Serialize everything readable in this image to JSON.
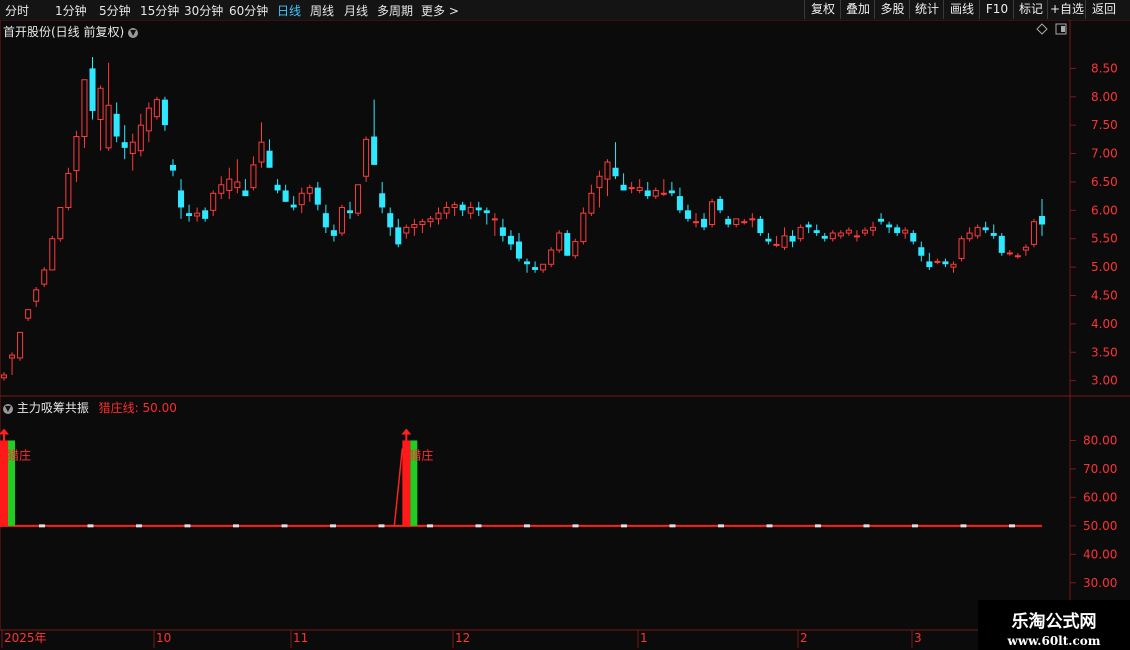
{
  "toolbar": {
    "periods": [
      "分时",
      "1分钟",
      "5分钟",
      "15分钟",
      "30分钟",
      "60分钟",
      "日线",
      "周线",
      "月线",
      "多周期",
      "更多"
    ],
    "active_period": "日线",
    "more_arrow": ">",
    "buttons": [
      "复权",
      "叠加",
      "多股",
      "统计",
      "画线",
      "F10",
      "标记",
      "+自选",
      "返回"
    ]
  },
  "chart": {
    "title": "首开股份(日线 前复权)",
    "price_ticks": [
      "8.50",
      "8.00",
      "7.50",
      "7.00",
      "6.50",
      "6.00",
      "5.50",
      "5.00",
      "4.50",
      "4.00",
      "3.50",
      "3.00"
    ],
    "x_labels": [
      "2025年",
      "10",
      "11",
      "12",
      "1",
      "2",
      "3"
    ]
  },
  "indicator": {
    "name": "主力吸筹共振",
    "line_label": "猎庄线: 50.00",
    "ticks": [
      "80.00",
      "70.00",
      "60.00",
      "50.00",
      "40.00",
      "30.00"
    ],
    "signal_label": "猎庄"
  },
  "watermark": {
    "line1": "乐淘公式网",
    "line2": "www.60lt.com"
  },
  "colors": {
    "up": "#ff3b3b",
    "down": "#2ee8ff",
    "signal_green": "#22cc22",
    "signal_red": "#ff1a1a",
    "axis": "#7a1a1a"
  },
  "chart_data": {
    "type": "candlestick",
    "ohlc": [
      [
        3.05,
        3.15,
        3.0,
        3.1
      ],
      [
        3.4,
        3.5,
        3.1,
        3.45
      ],
      [
        3.4,
        3.85,
        3.35,
        3.85
      ],
      [
        4.1,
        4.25,
        4.05,
        4.25
      ],
      [
        4.4,
        4.65,
        4.3,
        4.6
      ],
      [
        4.7,
        5.0,
        4.65,
        4.95
      ],
      [
        4.95,
        5.55,
        4.95,
        5.5
      ],
      [
        5.5,
        6.05,
        5.45,
        6.05
      ],
      [
        6.05,
        6.75,
        6.0,
        6.65
      ],
      [
        6.7,
        7.4,
        6.5,
        7.3
      ],
      [
        7.3,
        8.3,
        7.1,
        8.3
      ],
      [
        8.5,
        8.7,
        7.6,
        7.75
      ],
      [
        7.6,
        8.2,
        7.05,
        8.15
      ],
      [
        7.1,
        8.6,
        7.05,
        7.85
      ],
      [
        7.7,
        7.9,
        7.2,
        7.3
      ],
      [
        7.2,
        7.5,
        6.9,
        7.1
      ],
      [
        7.0,
        7.35,
        6.7,
        7.2
      ],
      [
        7.05,
        7.7,
        6.95,
        7.5
      ],
      [
        7.4,
        7.9,
        7.2,
        7.8
      ],
      [
        7.65,
        8.0,
        7.6,
        7.95
      ],
      [
        7.95,
        8.0,
        7.4,
        7.5
      ],
      [
        6.8,
        6.9,
        6.6,
        6.7
      ],
      [
        6.35,
        6.55,
        5.85,
        6.05
      ],
      [
        5.95,
        6.1,
        5.8,
        5.9
      ],
      [
        5.9,
        6.05,
        5.8,
        5.95
      ],
      [
        6.0,
        6.05,
        5.8,
        5.85
      ],
      [
        6.0,
        6.35,
        5.9,
        6.3
      ],
      [
        6.3,
        6.6,
        6.2,
        6.45
      ],
      [
        6.35,
        6.75,
        6.2,
        6.55
      ],
      [
        6.4,
        6.9,
        6.3,
        6.5
      ],
      [
        6.35,
        6.55,
        6.25,
        6.25
      ],
      [
        6.4,
        6.95,
        6.35,
        6.8
      ],
      [
        6.85,
        7.55,
        6.75,
        7.2
      ],
      [
        7.05,
        7.25,
        6.75,
        6.75
      ],
      [
        6.45,
        6.55,
        6.3,
        6.35
      ],
      [
        6.35,
        6.45,
        6.15,
        6.15
      ],
      [
        6.1,
        6.25,
        6.0,
        6.05
      ],
      [
        6.1,
        6.4,
        5.95,
        6.3
      ],
      [
        6.3,
        6.45,
        6.15,
        6.4
      ],
      [
        6.4,
        6.5,
        6.0,
        6.1
      ],
      [
        5.95,
        6.1,
        5.6,
        5.7
      ],
      [
        5.65,
        5.75,
        5.45,
        5.55
      ],
      [
        5.6,
        6.1,
        5.55,
        6.05
      ],
      [
        6.0,
        6.15,
        5.85,
        5.95
      ],
      [
        5.95,
        6.45,
        5.9,
        6.45
      ],
      [
        6.6,
        7.3,
        6.5,
        7.25
      ],
      [
        7.3,
        7.95,
        6.8,
        6.8
      ],
      [
        6.3,
        6.5,
        5.95,
        6.05
      ],
      [
        5.95,
        6.05,
        5.55,
        5.7
      ],
      [
        5.7,
        5.85,
        5.35,
        5.4
      ],
      [
        5.6,
        5.75,
        5.5,
        5.7
      ],
      [
        5.7,
        5.85,
        5.55,
        5.75
      ],
      [
        5.75,
        5.85,
        5.6,
        5.8
      ],
      [
        5.8,
        5.9,
        5.7,
        5.85
      ],
      [
        5.85,
        6.05,
        5.75,
        5.95
      ],
      [
        5.95,
        6.15,
        5.85,
        6.05
      ],
      [
        6.05,
        6.15,
        5.9,
        6.1
      ],
      [
        6.1,
        6.15,
        5.9,
        6.0
      ],
      [
        5.95,
        6.15,
        5.85,
        6.05
      ],
      [
        6.05,
        6.15,
        5.9,
        6.0
      ],
      [
        6.0,
        6.05,
        5.75,
        5.95
      ],
      [
        5.85,
        5.95,
        5.55,
        5.85
      ],
      [
        5.7,
        5.85,
        5.45,
        5.55
      ],
      [
        5.55,
        5.65,
        5.3,
        5.4
      ],
      [
        5.45,
        5.6,
        5.1,
        5.15
      ],
      [
        5.1,
        5.15,
        4.9,
        5.05
      ],
      [
        5.0,
        5.1,
        4.9,
        4.95
      ],
      [
        4.95,
        5.05,
        4.9,
        5.05
      ],
      [
        5.05,
        5.35,
        5.0,
        5.3
      ],
      [
        5.3,
        5.65,
        5.25,
        5.6
      ],
      [
        5.6,
        5.65,
        5.2,
        5.2
      ],
      [
        5.2,
        5.5,
        5.15,
        5.45
      ],
      [
        5.45,
        6.05,
        5.4,
        5.95
      ],
      [
        5.95,
        6.45,
        5.9,
        6.3
      ],
      [
        6.4,
        6.7,
        6.05,
        6.6
      ],
      [
        6.55,
        6.9,
        6.25,
        6.85
      ],
      [
        6.75,
        7.2,
        6.55,
        6.6
      ],
      [
        6.45,
        6.65,
        6.35,
        6.35
      ],
      [
        6.4,
        6.5,
        6.3,
        6.4
      ],
      [
        6.35,
        6.55,
        6.3,
        6.4
      ],
      [
        6.35,
        6.5,
        6.2,
        6.25
      ],
      [
        6.25,
        6.4,
        6.2,
        6.35
      ],
      [
        6.3,
        6.55,
        6.25,
        6.3
      ],
      [
        6.35,
        6.5,
        6.25,
        6.3
      ],
      [
        6.25,
        6.4,
        5.95,
        6.0
      ],
      [
        6.0,
        6.1,
        5.8,
        5.85
      ],
      [
        5.8,
        5.95,
        5.7,
        5.8
      ],
      [
        5.85,
        5.95,
        5.65,
        5.7
      ],
      [
        5.75,
        6.2,
        5.7,
        6.15
      ],
      [
        6.2,
        6.25,
        5.95,
        6.0
      ],
      [
        5.85,
        5.9,
        5.7,
        5.75
      ],
      [
        5.75,
        5.85,
        5.7,
        5.85
      ],
      [
        5.8,
        5.85,
        5.75,
        5.8
      ],
      [
        5.85,
        5.95,
        5.7,
        5.85
      ],
      [
        5.85,
        5.9,
        5.55,
        5.6
      ],
      [
        5.5,
        5.6,
        5.4,
        5.45
      ],
      [
        5.4,
        5.55,
        5.35,
        5.4
      ],
      [
        5.35,
        5.7,
        5.3,
        5.55
      ],
      [
        5.55,
        5.65,
        5.35,
        5.45
      ],
      [
        5.5,
        5.75,
        5.45,
        5.7
      ],
      [
        5.75,
        5.8,
        5.6,
        5.7
      ],
      [
        5.65,
        5.75,
        5.55,
        5.6
      ],
      [
        5.55,
        5.6,
        5.45,
        5.5
      ],
      [
        5.5,
        5.65,
        5.45,
        5.6
      ],
      [
        5.55,
        5.65,
        5.5,
        5.6
      ],
      [
        5.6,
        5.7,
        5.55,
        5.65
      ],
      [
        5.55,
        5.65,
        5.45,
        5.55
      ],
      [
        5.6,
        5.7,
        5.55,
        5.65
      ],
      [
        5.65,
        5.8,
        5.55,
        5.7
      ],
      [
        5.85,
        5.95,
        5.75,
        5.8
      ],
      [
        5.75,
        5.8,
        5.6,
        5.7
      ],
      [
        5.7,
        5.75,
        5.55,
        5.6
      ],
      [
        5.6,
        5.7,
        5.5,
        5.65
      ],
      [
        5.6,
        5.65,
        5.4,
        5.45
      ],
      [
        5.35,
        5.45,
        5.1,
        5.2
      ],
      [
        5.1,
        5.25,
        4.95,
        5.0
      ],
      [
        5.1,
        5.15,
        5.05,
        5.1
      ],
      [
        5.1,
        5.15,
        5.0,
        5.05
      ],
      [
        5.0,
        5.1,
        4.9,
        5.05
      ],
      [
        5.15,
        5.55,
        5.1,
        5.5
      ],
      [
        5.5,
        5.7,
        5.45,
        5.6
      ],
      [
        5.55,
        5.75,
        5.5,
        5.7
      ],
      [
        5.7,
        5.8,
        5.6,
        5.65
      ],
      [
        5.6,
        5.75,
        5.5,
        5.55
      ],
      [
        5.55,
        5.6,
        5.2,
        5.25
      ],
      [
        5.25,
        5.3,
        5.2,
        5.25
      ],
      [
        5.2,
        5.25,
        5.15,
        5.2
      ],
      [
        5.3,
        5.4,
        5.2,
        5.35
      ],
      [
        5.4,
        5.85,
        5.35,
        5.8
      ],
      [
        5.9,
        6.2,
        5.55,
        5.75
      ]
    ],
    "price_ylim": [
      2.8,
      9.0
    ],
    "indicator": {
      "baseline": 50,
      "ylim": [
        25,
        90
      ],
      "signals": [
        {
          "index": 0,
          "red": 80,
          "green": 80
        },
        {
          "index": 50,
          "red": 80,
          "green": 80
        }
      ]
    }
  }
}
